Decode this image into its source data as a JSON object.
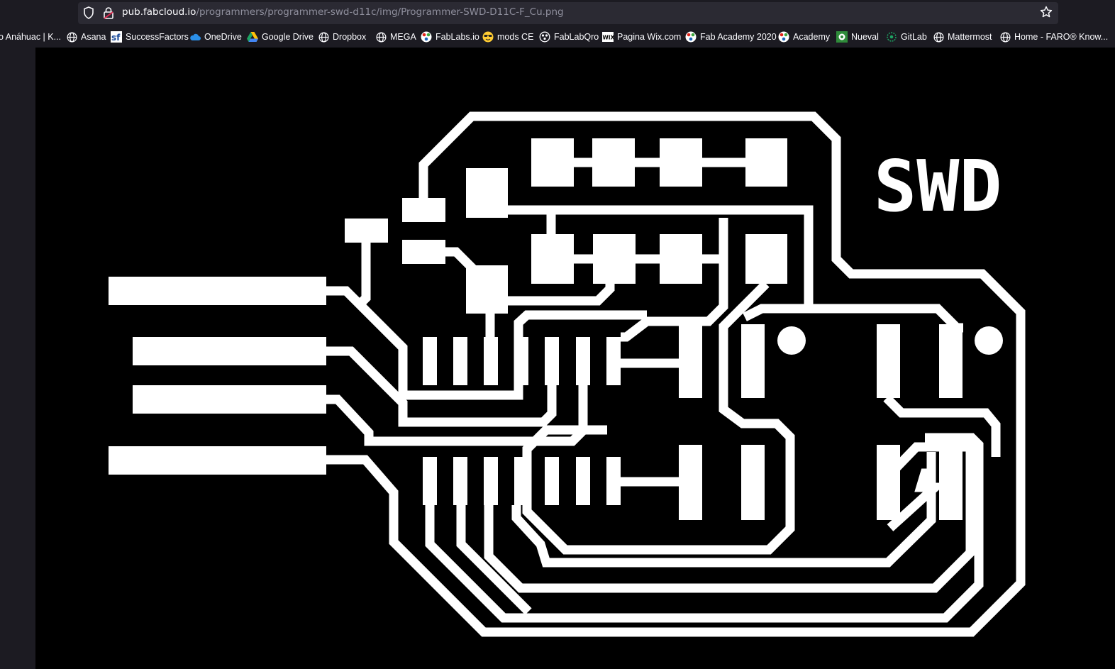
{
  "browser": {
    "url_host": "pub.fabcloud.io",
    "url_path": "/programmers/programmer-swd-d11c/img/Programmer-SWD-D11C-F_Cu.png"
  },
  "bookmarks": [
    {
      "label": "o Anáhuac | K...",
      "icon": "none"
    },
    {
      "label": "Asana",
      "icon": "globe-icon"
    },
    {
      "label": "SuccessFactors",
      "icon": "successfactors-icon"
    },
    {
      "label": "OneDrive",
      "icon": "cloud-icon"
    },
    {
      "label": "Google Drive",
      "icon": "google-drive-icon"
    },
    {
      "label": "Dropbox",
      "icon": "globe-icon"
    },
    {
      "label": "MEGA",
      "icon": "globe-icon"
    },
    {
      "label": "FabLabs.io",
      "icon": "fablabs-icon"
    },
    {
      "label": "mods CE",
      "icon": "sunglasses-emoji-icon"
    },
    {
      "label": "FabLabQro",
      "icon": "fablab-logo-icon"
    },
    {
      "label": "Pagina Wix.com",
      "icon": "wix-icon"
    },
    {
      "label": "Fab Academy 2020",
      "icon": "fablabs-icon"
    },
    {
      "label": "Academy",
      "icon": "fablabs-icon"
    },
    {
      "label": "Nueval",
      "icon": "nueval-icon"
    },
    {
      "label": "GitLab",
      "icon": "gitlab-icon"
    },
    {
      "label": "Mattermost",
      "icon": "globe-icon"
    },
    {
      "label": "Home - FARO® Know...",
      "icon": "globe-icon"
    }
  ],
  "image": {
    "board_label": "SWD",
    "trace_color": "#ffffff",
    "background_color": "#000000"
  }
}
